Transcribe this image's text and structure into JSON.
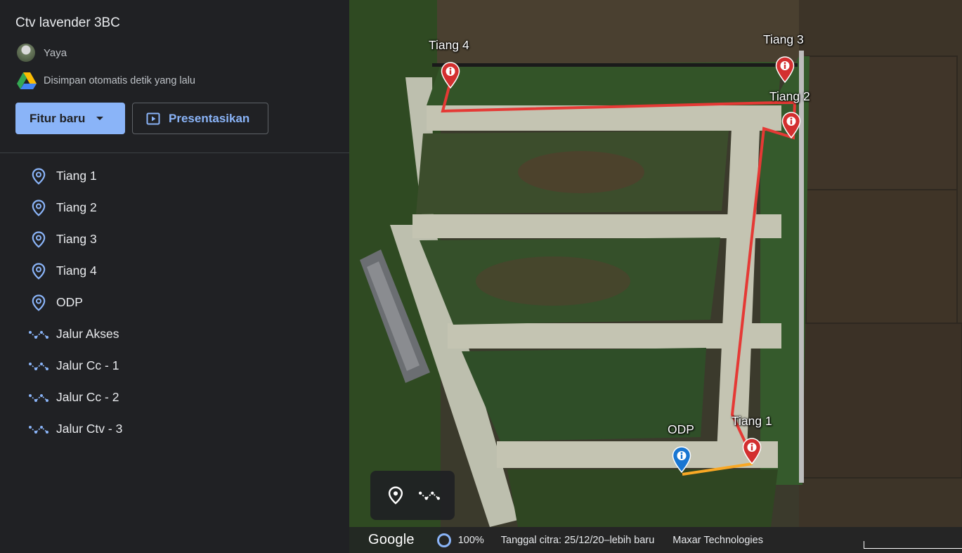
{
  "project": {
    "title": "Ctv lavender 3BC",
    "owner": "Yaya",
    "save_status": "Disimpan otomatis detik yang lalu"
  },
  "buttons": {
    "new_feature": "Fitur baru",
    "present": "Presentasikan"
  },
  "layers": [
    {
      "label": "Tiang 1",
      "icon": "place-pin-icon"
    },
    {
      "label": "Tiang 2",
      "icon": "place-pin-icon"
    },
    {
      "label": "Tiang 3",
      "icon": "place-pin-icon"
    },
    {
      "label": "Tiang 4",
      "icon": "place-pin-icon"
    },
    {
      "label": "ODP",
      "icon": "place-pin-icon"
    },
    {
      "label": "Jalur Akses",
      "icon": "path-icon"
    },
    {
      "label": "Jalur Cc - 1",
      "icon": "path-icon"
    },
    {
      "label": "Jalur Cc - 2",
      "icon": "path-icon"
    },
    {
      "label": "Jalur Ctv - 3",
      "icon": "path-icon"
    }
  ],
  "map": {
    "labels": {
      "tiang4": "Tiang 4",
      "tiang3": "Tiang 3",
      "tiang2": "Tiang 2",
      "tiang1": "Tiang 1",
      "odp": "ODP"
    },
    "colors": {
      "pole_pin": "#d32f2f",
      "odp_pin": "#1976d2",
      "route_line": "#e53935",
      "access_line": "#f9a825",
      "accent": "#8ab4f8"
    }
  },
  "footer": {
    "brand": "Google",
    "zoom": "100%",
    "imagery_date": "Tanggal citra: 25/12/20–lebih baru",
    "provider": "Maxar Technologies"
  }
}
